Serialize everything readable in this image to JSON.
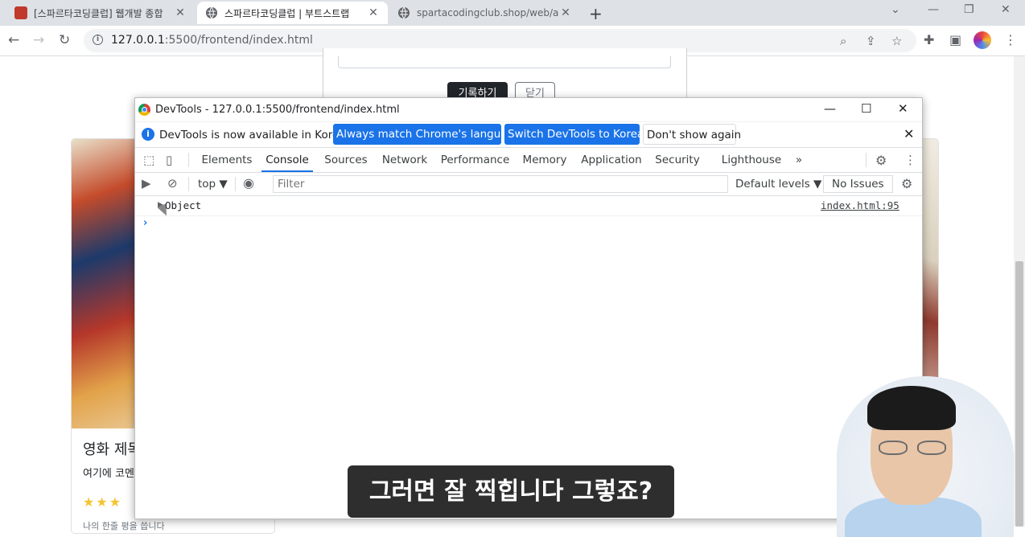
{
  "browser": {
    "tabs": [
      {
        "title": "[스파르타코딩클럽] 웹개발 종합",
        "icon": "bookmark-red-icon",
        "active": false
      },
      {
        "title": "스파르타코딩클럽 | 부트스트랩",
        "icon": "globe-icon",
        "active": true
      },
      {
        "title": "spartacodingclub.shop/web/api/",
        "icon": "globe-icon",
        "active": false
      }
    ],
    "url_host": "127.0.0.1",
    "url_path": ":5500/frontend/index.html"
  },
  "page": {
    "modal_save_button": "기록하기",
    "modal_close_button": "닫기",
    "card_title": "영화 제목",
    "card_text": "여기에 코멘트",
    "stars": "★★★",
    "card_footer": "나의 한줄 평을 씁니다"
  },
  "devtools": {
    "window_title": "DevTools - 127.0.0.1:5500/frontend/index.html",
    "infobar": {
      "message": "DevTools is now available in Korean!",
      "match_language_button": "Always match Chrome's language",
      "switch_korean_button": "Switch DevTools to Korean",
      "dont_show_button": "Don't show again"
    },
    "tabs": [
      "Elements",
      "Console",
      "Sources",
      "Network",
      "Performance",
      "Memory",
      "Application",
      "Security",
      "Lighthouse"
    ],
    "active_tab": "Console",
    "more_tabs": "»",
    "console": {
      "context": "top ▼",
      "filter_placeholder": "Filter",
      "levels": "Default levels ▼",
      "issues": "No Issues",
      "log_entry": "Object",
      "log_source": "index.html:95",
      "prompt": "›"
    }
  },
  "overlay": {
    "caption": "그러면 잘 찍힙니다 그렇죠?"
  }
}
